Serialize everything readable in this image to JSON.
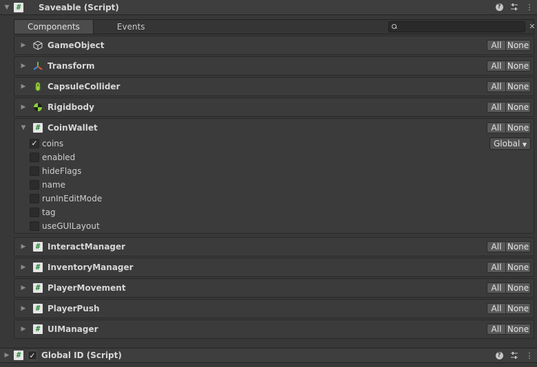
{
  "header": {
    "title": "Saveable (Script)",
    "icon": "script-hash-icon"
  },
  "tabs": [
    {
      "label": "Components",
      "active": true
    },
    {
      "label": "Events",
      "active": false
    }
  ],
  "search": {
    "value": "",
    "placeholder": ""
  },
  "buttons": {
    "all": "All",
    "none": "None"
  },
  "components": [
    {
      "name": "GameObject",
      "icon": "cube-icon",
      "expanded": false
    },
    {
      "name": "Transform",
      "icon": "transform-axes-icon",
      "expanded": false
    },
    {
      "name": "CapsuleCollider",
      "icon": "capsule-collider-icon",
      "expanded": false
    },
    {
      "name": "Rigidbody",
      "icon": "rigidbody-icon",
      "expanded": false
    },
    {
      "name": "CoinWallet",
      "icon": "script-hash-icon",
      "expanded": true,
      "fields": [
        {
          "name": "coins",
          "checked": true,
          "scope": "Global"
        },
        {
          "name": "enabled",
          "checked": false
        },
        {
          "name": "hideFlags",
          "checked": false
        },
        {
          "name": "name",
          "checked": false
        },
        {
          "name": "runInEditMode",
          "checked": false
        },
        {
          "name": "tag",
          "checked": false
        },
        {
          "name": "useGUILayout",
          "checked": false
        }
      ]
    },
    {
      "name": "InteractManager",
      "icon": "script-hash-icon",
      "expanded": false
    },
    {
      "name": "InventoryManager",
      "icon": "script-hash-icon",
      "expanded": false
    },
    {
      "name": "PlayerMovement",
      "icon": "script-hash-icon",
      "expanded": false
    },
    {
      "name": "PlayerPush",
      "icon": "script-hash-icon",
      "expanded": false
    },
    {
      "name": "UIManager",
      "icon": "script-hash-icon",
      "expanded": false
    }
  ],
  "footer": {
    "title": "Global ID (Script)",
    "enabled": true,
    "icon": "script-hash-icon"
  },
  "colors": {
    "background": "#383838",
    "header": "#3e3e3e",
    "script_icon_green": "#2e8b3a"
  }
}
